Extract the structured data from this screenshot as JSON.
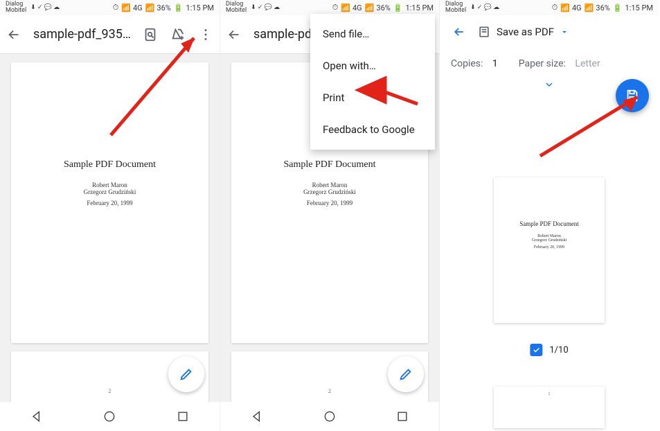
{
  "statusbar": {
    "carrier_line1": "Dialog",
    "carrier_line2": "Mobitel",
    "battery": "36%",
    "time": "1:15 PM",
    "net": "4G"
  },
  "toolbar": {
    "filename_full": "sample-pdf_935…",
    "filename_short": "sample-pd"
  },
  "doc": {
    "title": "Sample PDF Document",
    "author1": "Robert Maron",
    "author2": "Grzegorz Grudziński",
    "date": "February 20, 1999",
    "page2_no": "2"
  },
  "menu": {
    "send": "Send file…",
    "openwith": "Open with…",
    "print": "Print",
    "feedback": "Feedback to Google"
  },
  "print": {
    "dest": "Save as PDF",
    "copies_label": "Copies:",
    "copies_value": "1",
    "paper_label": "Paper size:",
    "paper_value": "Letter",
    "page_indicator": "1/10"
  }
}
